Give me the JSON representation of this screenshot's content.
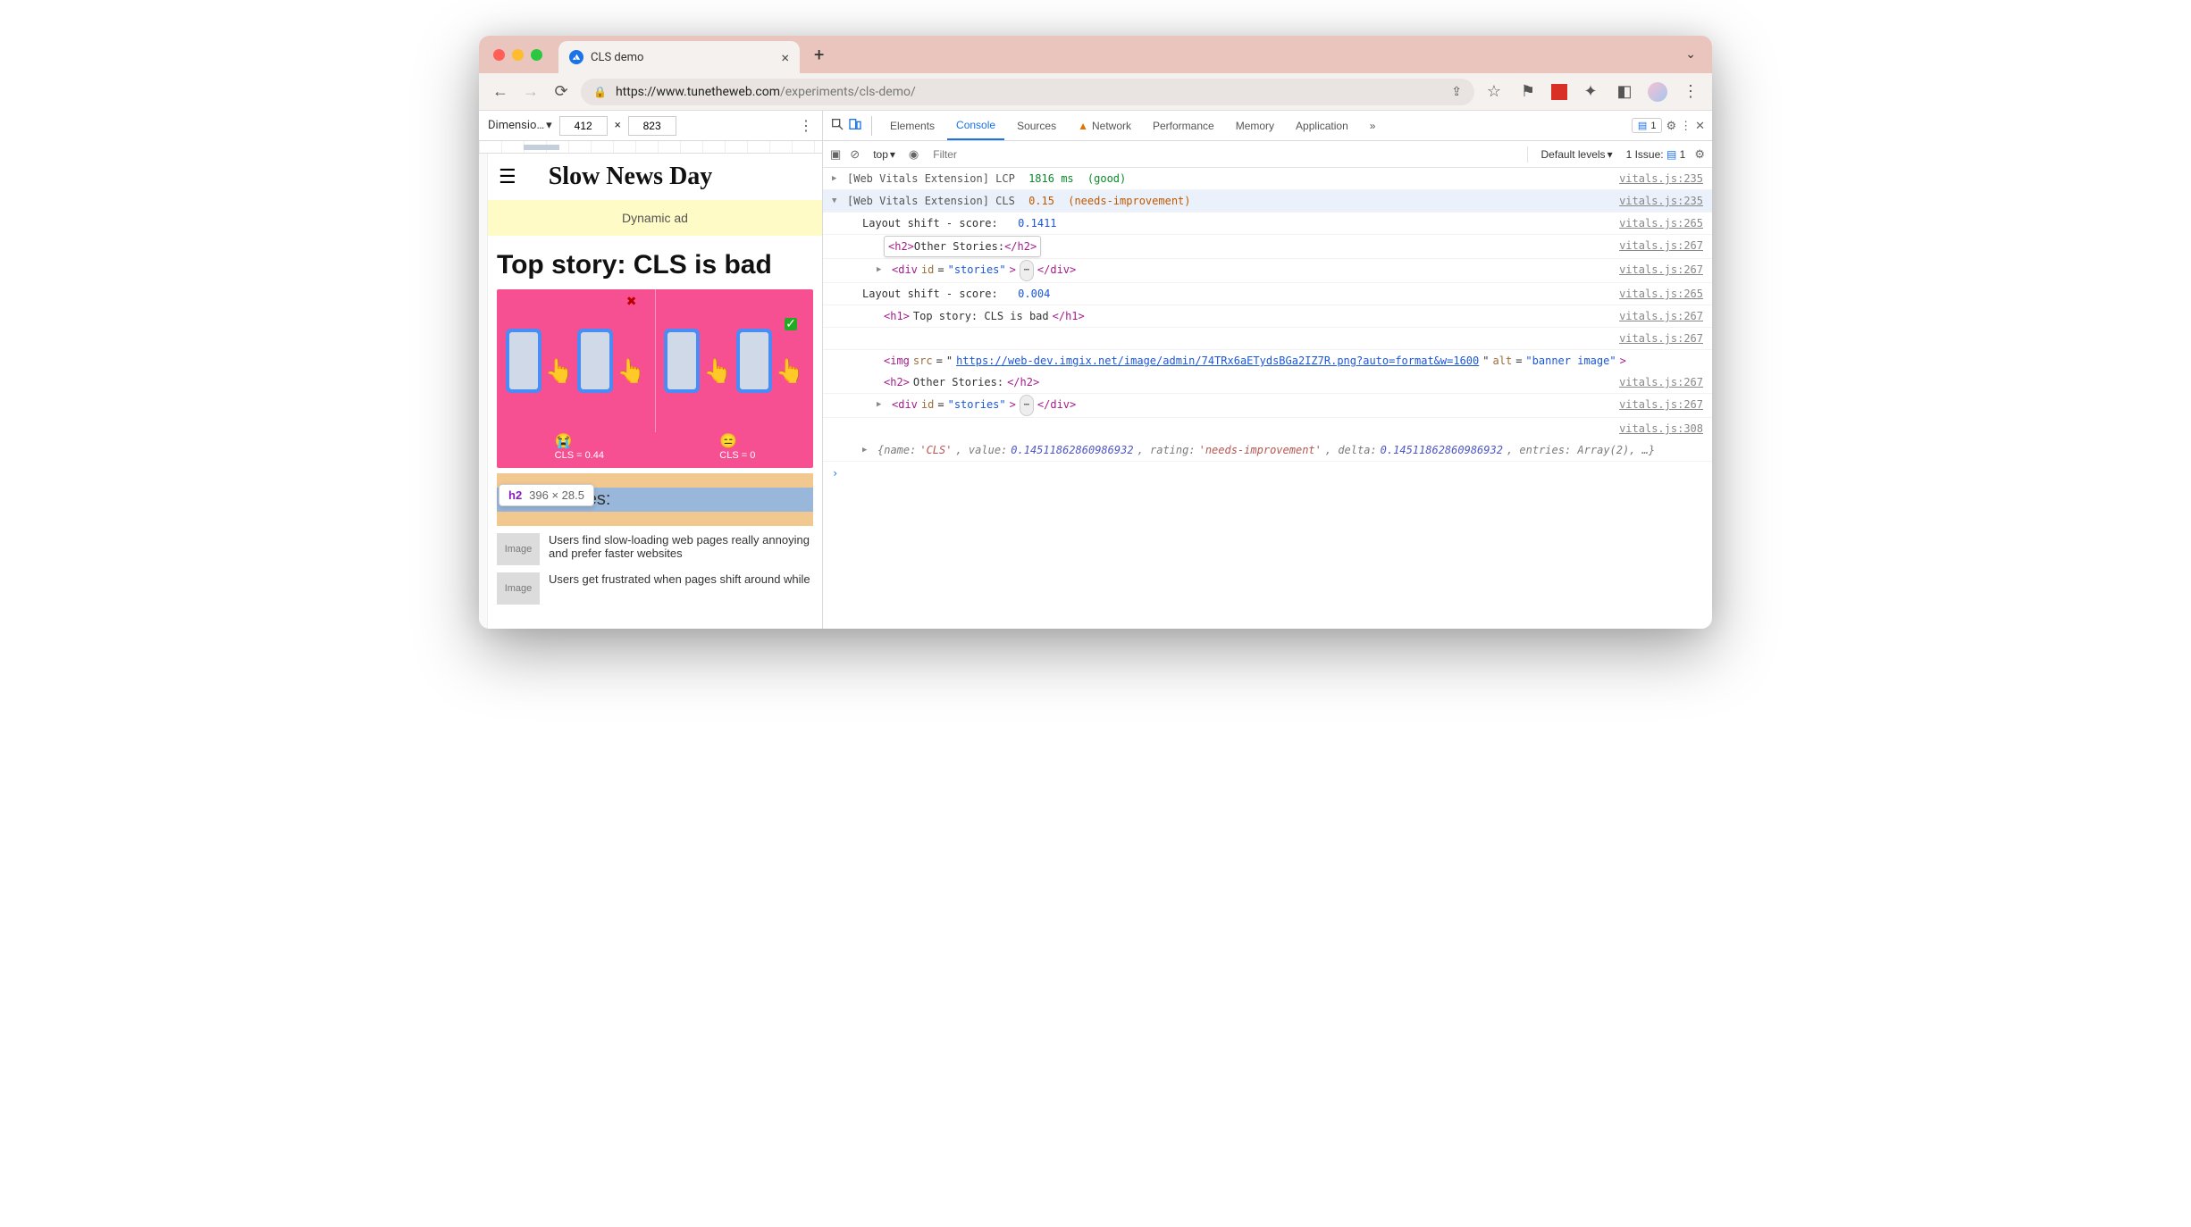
{
  "browser": {
    "tab_title": "CLS demo",
    "url_host": "https://www.tunetheweb.com",
    "url_path": "/experiments/cls-demo/"
  },
  "device_toolbar": {
    "label": "Dimensio…",
    "width": "412",
    "times": "×",
    "height": "823"
  },
  "page": {
    "site_title": "Slow News Day",
    "ad_text": "Dynamic ad",
    "headline": "Top story: CLS is bad",
    "banner_left_label": "CLS = 0.44",
    "banner_right_label": "CLS = 0",
    "other_stories": "Other Stories:",
    "tooltip_tag": "h2",
    "tooltip_dims": "396 × 28.5",
    "stories": [
      {
        "img": "Image",
        "text": "Users find slow-loading web pages really annoying and prefer faster websites"
      },
      {
        "img": "Image",
        "text": "Users get frustrated when pages shift around while"
      }
    ]
  },
  "devtools": {
    "tabs": [
      "Elements",
      "Console",
      "Sources",
      "Network",
      "Performance",
      "Memory",
      "Application"
    ],
    "filter_placeholder": "Filter",
    "context": "top",
    "levels": "Default levels",
    "issues_label": "1 Issue:",
    "issues_count": "1",
    "chip_count": "1"
  },
  "console": {
    "lcp_prefix": "[Web Vitals Extension] LCP",
    "lcp_value": "1816 ms",
    "lcp_rating": "(good)",
    "cls_prefix": "[Web Vitals Extension] CLS",
    "cls_value": "0.15",
    "cls_rating": "(needs-improvement)",
    "src_235": "vitals.js:235",
    "src_265": "vitals.js:265",
    "src_267": "vitals.js:267",
    "src_308": "vitals.js:308",
    "shift1_label": "Layout shift - score:",
    "shift1_val": "0.1411",
    "h2_inner": "Other Stories:",
    "div_stories": "div",
    "div_attr": "id",
    "div_attr_val": "\"stories\"",
    "shift2_label": "Layout shift - score:",
    "shift2_val": "0.004",
    "h1_inner": "Top story: CLS is bad",
    "img_src_label": "img",
    "img_src_val": "https://web-dev.imgix.net/image/admin/74TRx6aETydsBGa2IZ7R.png?auto=format&w=1600",
    "img_alt": "banner image",
    "obj": "{name: 'CLS', value: 0.14511862860986932, rating: 'needs-improvement', delta: 0.14511862860986932, entries: Array(2), …}"
  }
}
